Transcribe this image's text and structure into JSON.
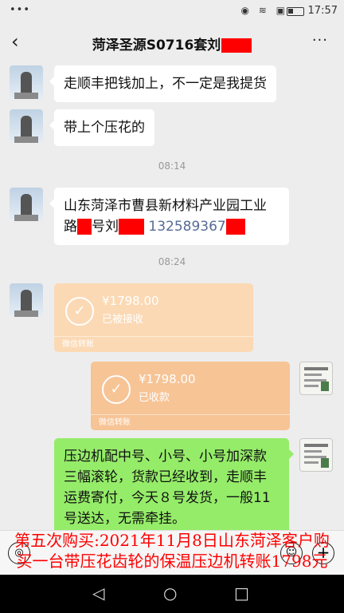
{
  "status_bar": {
    "dots": "•••",
    "icons": "◉ ≋ ▣",
    "time": "17:57"
  },
  "header": {
    "back_icon": "‹",
    "title": "菏泽圣源S0716套刘",
    "more_icon": "···"
  },
  "messages": {
    "m1": "走顺丰把钱加上，不一定是我提货",
    "m2": "带上个压花的",
    "time1": "08:14",
    "m3_line1": "山东菏泽市曹县新材料产业园工业",
    "m3_line2a": "路",
    "m3_line2b": "号刘",
    "m3_phone": "132589367",
    "time2": "08:24"
  },
  "transfers": [
    {
      "icon": "✓",
      "amount": "¥1798.00",
      "status": "已被接收",
      "label": "微信转账",
      "color": "#fbd9b4"
    },
    {
      "icon": "✓",
      "amount": "¥1798.00",
      "status": "已收款",
      "label": "微信转账",
      "color": "#f7c496"
    }
  ],
  "reply": {
    "line1": "压边机配中号、小号、小号加深款",
    "line2": "三幅滚轮，货款已经收到，走顺丰",
    "line3": "运费寄付，今天８号发货，一般11",
    "line4": "号送达，无需牵挂。"
  },
  "input_bar": {
    "voice_icon": "◎",
    "emoji_icon": "☺",
    "plus_icon": "+"
  },
  "overlay": {
    "line1": "第五次购买:2021年11月8日山东菏泽客户购",
    "line2": "买一台带压花齿轮的保温压边机转账1798元"
  },
  "nav": {
    "back": "◁",
    "home": "○",
    "recent": "□"
  }
}
